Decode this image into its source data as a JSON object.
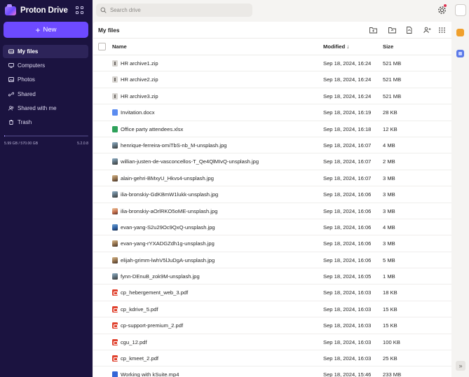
{
  "sidebar": {
    "brand": "Proton Drive",
    "new_label": "New",
    "items": [
      {
        "label": "My files",
        "icon": "hard-drive-icon",
        "active": true
      },
      {
        "label": "Computers",
        "icon": "monitor-icon",
        "active": false
      },
      {
        "label": "Photos",
        "icon": "image-icon",
        "active": false
      },
      {
        "label": "Shared",
        "icon": "link-icon",
        "active": false
      },
      {
        "label": "Shared with me",
        "icon": "users-icon",
        "active": false
      },
      {
        "label": "Trash",
        "icon": "trash-icon",
        "active": false
      }
    ],
    "storage_used": "5.99 GB / 570.00 GB",
    "storage_fraction": 0.0105,
    "version": "5.2.0.8"
  },
  "search": {
    "placeholder": "Search drive"
  },
  "main": {
    "title": "My files",
    "columns": {
      "name": "Name",
      "modified": "Modified",
      "size": "Size",
      "sort_arrow": "↓"
    },
    "rows": [
      {
        "name": "HR archive1.zip",
        "modified": "Sep 18, 2024, 16:24",
        "size": "521 MB",
        "icon": "zip"
      },
      {
        "name": "HR archive2.zip",
        "modified": "Sep 18, 2024, 16:24",
        "size": "521 MB",
        "icon": "zip"
      },
      {
        "name": "HR archive3.zip",
        "modified": "Sep 18, 2024, 16:24",
        "size": "521 MB",
        "icon": "zip"
      },
      {
        "name": "Invitation.docx",
        "modified": "Sep 18, 2024, 16:19",
        "size": "28 KB",
        "icon": "doc"
      },
      {
        "name": "Office party attendees.xlsx",
        "modified": "Sep 18, 2024, 16:18",
        "size": "12 KB",
        "icon": "xls"
      },
      {
        "name": "henrique-ferreira-omiTbS-nb_M-unsplash.jpg",
        "modified": "Sep 18, 2024, 16:07",
        "size": "4 MB",
        "icon": "img"
      },
      {
        "name": "willian-justen-de-vasconcellos-T_Qe4QlMIvQ-unsplash.jpg",
        "modified": "Sep 18, 2024, 16:07",
        "size": "2 MB",
        "icon": "img"
      },
      {
        "name": "alain-gehri-BMxyU_Hkvs4-unsplash.jpg",
        "modified": "Sep 18, 2024, 16:07",
        "size": "3 MB",
        "icon": "img2"
      },
      {
        "name": "ilia-bronskiy-GdKBmW1lukk-unsplash.jpg",
        "modified": "Sep 18, 2024, 16:06",
        "size": "3 MB",
        "icon": "img"
      },
      {
        "name": "ilia-bronskiy-aOrlRKO5oME-unsplash.jpg",
        "modified": "Sep 18, 2024, 16:06",
        "size": "3 MB",
        "icon": "img3"
      },
      {
        "name": "evan-yang-S2u29Oc9QxQ-unsplash.jpg",
        "modified": "Sep 18, 2024, 16:06",
        "size": "4 MB",
        "icon": "img4"
      },
      {
        "name": "evan-yang-rYXADGZdh1g-unsplash.jpg",
        "modified": "Sep 18, 2024, 16:06",
        "size": "3 MB",
        "icon": "img2"
      },
      {
        "name": "elijah-grimm-lwhV5lJuDgA-unsplash.jpg",
        "modified": "Sep 18, 2024, 16:06",
        "size": "5 MB",
        "icon": "img2"
      },
      {
        "name": "fynn-DEnuB_zok9M-unsplash.jpg",
        "modified": "Sep 18, 2024, 16:05",
        "size": "1 MB",
        "icon": "img"
      },
      {
        "name": "cp_hebergement_web_3.pdf",
        "modified": "Sep 18, 2024, 16:03",
        "size": "18 KB",
        "icon": "pdf"
      },
      {
        "name": "cp_kdrive_5.pdf",
        "modified": "Sep 18, 2024, 16:03",
        "size": "15 KB",
        "icon": "pdf"
      },
      {
        "name": "cp-support-premium_2.pdf",
        "modified": "Sep 18, 2024, 16:03",
        "size": "15 KB",
        "icon": "pdf"
      },
      {
        "name": "cgu_12.pdf",
        "modified": "Sep 18, 2024, 16:03",
        "size": "100 KB",
        "icon": "pdf"
      },
      {
        "name": "cp_kmeet_2.pdf",
        "modified": "Sep 18, 2024, 16:03",
        "size": "25 KB",
        "icon": "pdf"
      },
      {
        "name": "Working with kSuite.mp4",
        "modified": "Sep 18, 2024, 15:46",
        "size": "233 MB",
        "icon": "mp4"
      }
    ]
  },
  "colors": {
    "accent": "#6d4aff",
    "sidebar_bg": "#1b1340",
    "notification": "#dc3251"
  }
}
